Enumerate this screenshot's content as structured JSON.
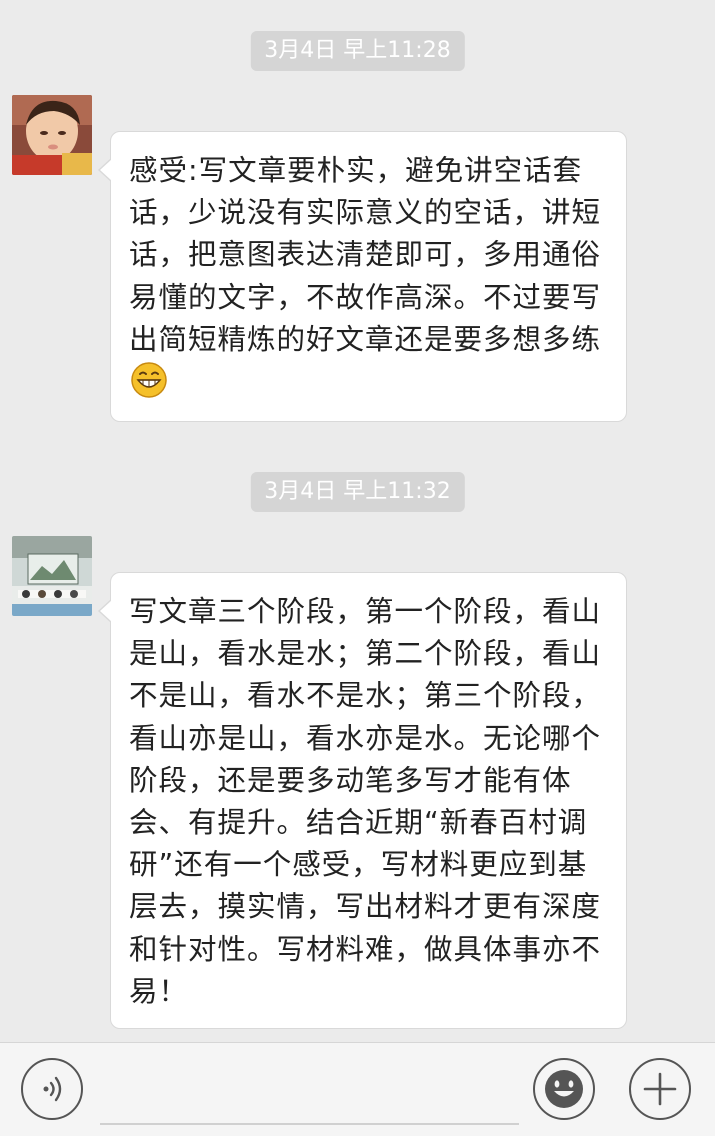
{
  "messages": [
    {
      "timestamp": "3月4日 早上11:28",
      "avatar_icon": "toddler-photo",
      "text": "感受:写文章要朴实，避免讲空话套话，少说没有实际意义的空话，讲短话，把意图表达清楚即可，多用通俗易懂的文字，不故作高深。不过要写出简短精炼的好文章还是要多想多练",
      "emoji": "grinning-face-icon"
    },
    {
      "timestamp": "3月4日 早上11:32",
      "avatar_icon": "meeting-room-photo",
      "text": "写文章三个阶段，第一个阶段，看山是山，看水是水；第二个阶段，看山不是山，看水不是水；第三个阶段，看山亦是山，看水亦是水。无论哪个阶段，还是要多动笔多写才能有体会、有提升。结合近期“新春百村调研”还有一个感受，写材料更应到基层去，摸实情，写出材料才更有深度和针对性。写材料难，做具体事亦不易！"
    }
  ],
  "input_bar": {
    "voice_icon": "voice-icon",
    "emoji_icon": "smiley-icon",
    "more_icon": "plus-icon",
    "placeholder": ""
  },
  "colors": {
    "background": "#ebebeb",
    "bubble": "#ffffff",
    "timestamp_bg": "#d5d5d5",
    "emoji_yellow": "#f5c02a"
  }
}
